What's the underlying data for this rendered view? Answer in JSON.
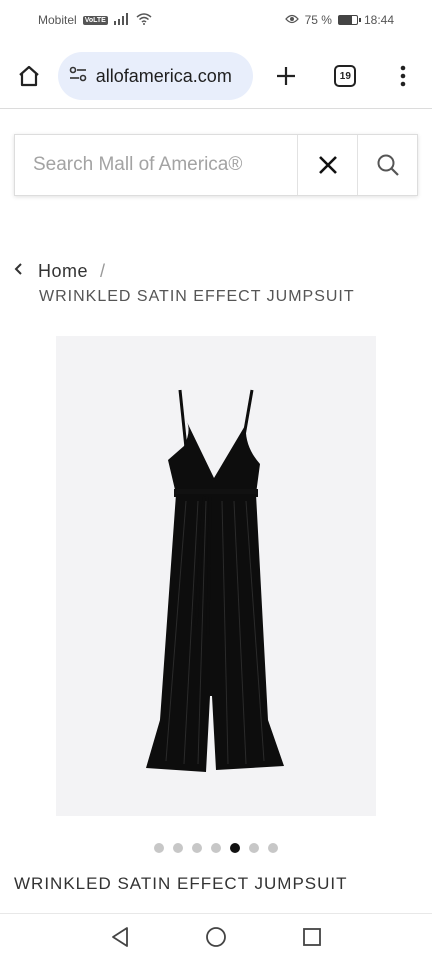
{
  "status_bar": {
    "carrier": "Mobitel",
    "volte": "VoLTE",
    "battery_percent": "75 %",
    "battery_level": 0.75,
    "time": "18:44"
  },
  "browser": {
    "url": "allofamerica.com",
    "tab_count": "19"
  },
  "search": {
    "placeholder": "Search Mall of America®"
  },
  "breadcrumb": {
    "home": "Home",
    "separator": "/",
    "current": "WRINKLED SATIN EFFECT JUMPSUIT"
  },
  "gallery": {
    "total": 7,
    "active_index": 4
  },
  "product": {
    "title": "WRINKLED SATIN EFFECT JUMPSUIT"
  },
  "colors": {
    "url_pill": "#e8eefb",
    "image_bg": "#f3f3f5",
    "garment": "#0d0d0d"
  }
}
